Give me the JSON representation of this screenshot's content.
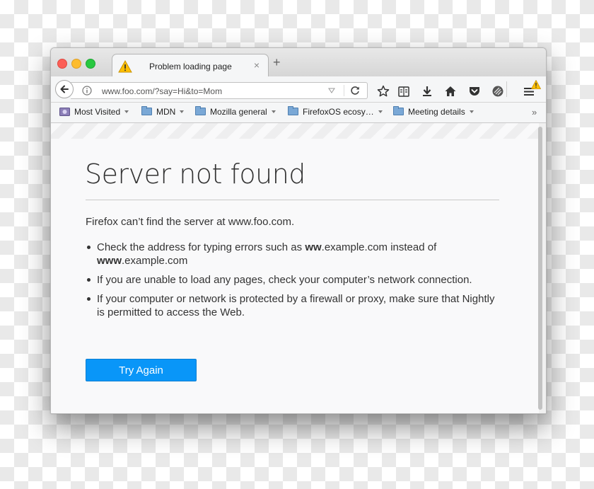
{
  "tab": {
    "title": "Problem loading page",
    "close_glyph": "×"
  },
  "newtab_glyph": "+",
  "urlbar": {
    "url": "www.foo.com/?say=Hi&to=Mom"
  },
  "bookmarks": [
    {
      "label": "Most Visited",
      "icon": "most-visited-icon"
    },
    {
      "label": "MDN",
      "icon": "folder-icon"
    },
    {
      "label": "Mozilla general",
      "icon": "folder-icon"
    },
    {
      "label": "FirefoxOS ecosy…",
      "icon": "folder-icon"
    },
    {
      "label": "Meeting details",
      "icon": "folder-icon"
    }
  ],
  "bookmarks_overflow_glyph": "»",
  "error": {
    "title": "Server not found",
    "description": "Firefox can’t find the server at www.foo.com.",
    "bullets": [
      {
        "text_a": "Check the address for typing errors such as ",
        "bold_a": "ww",
        "text_b": ".example.com instead of ",
        "bold_b": "www",
        "text_c": ".example.com"
      },
      {
        "text": "If you are unable to load any pages, check your computer’s network connection."
      },
      {
        "text": "If your computer or network is protected by a firewall or proxy, make sure that Nightly is permitted to access the Web."
      }
    ],
    "button": "Try Again"
  },
  "colors": {
    "accent": "#0996f8",
    "warning": "#ffbf00"
  }
}
